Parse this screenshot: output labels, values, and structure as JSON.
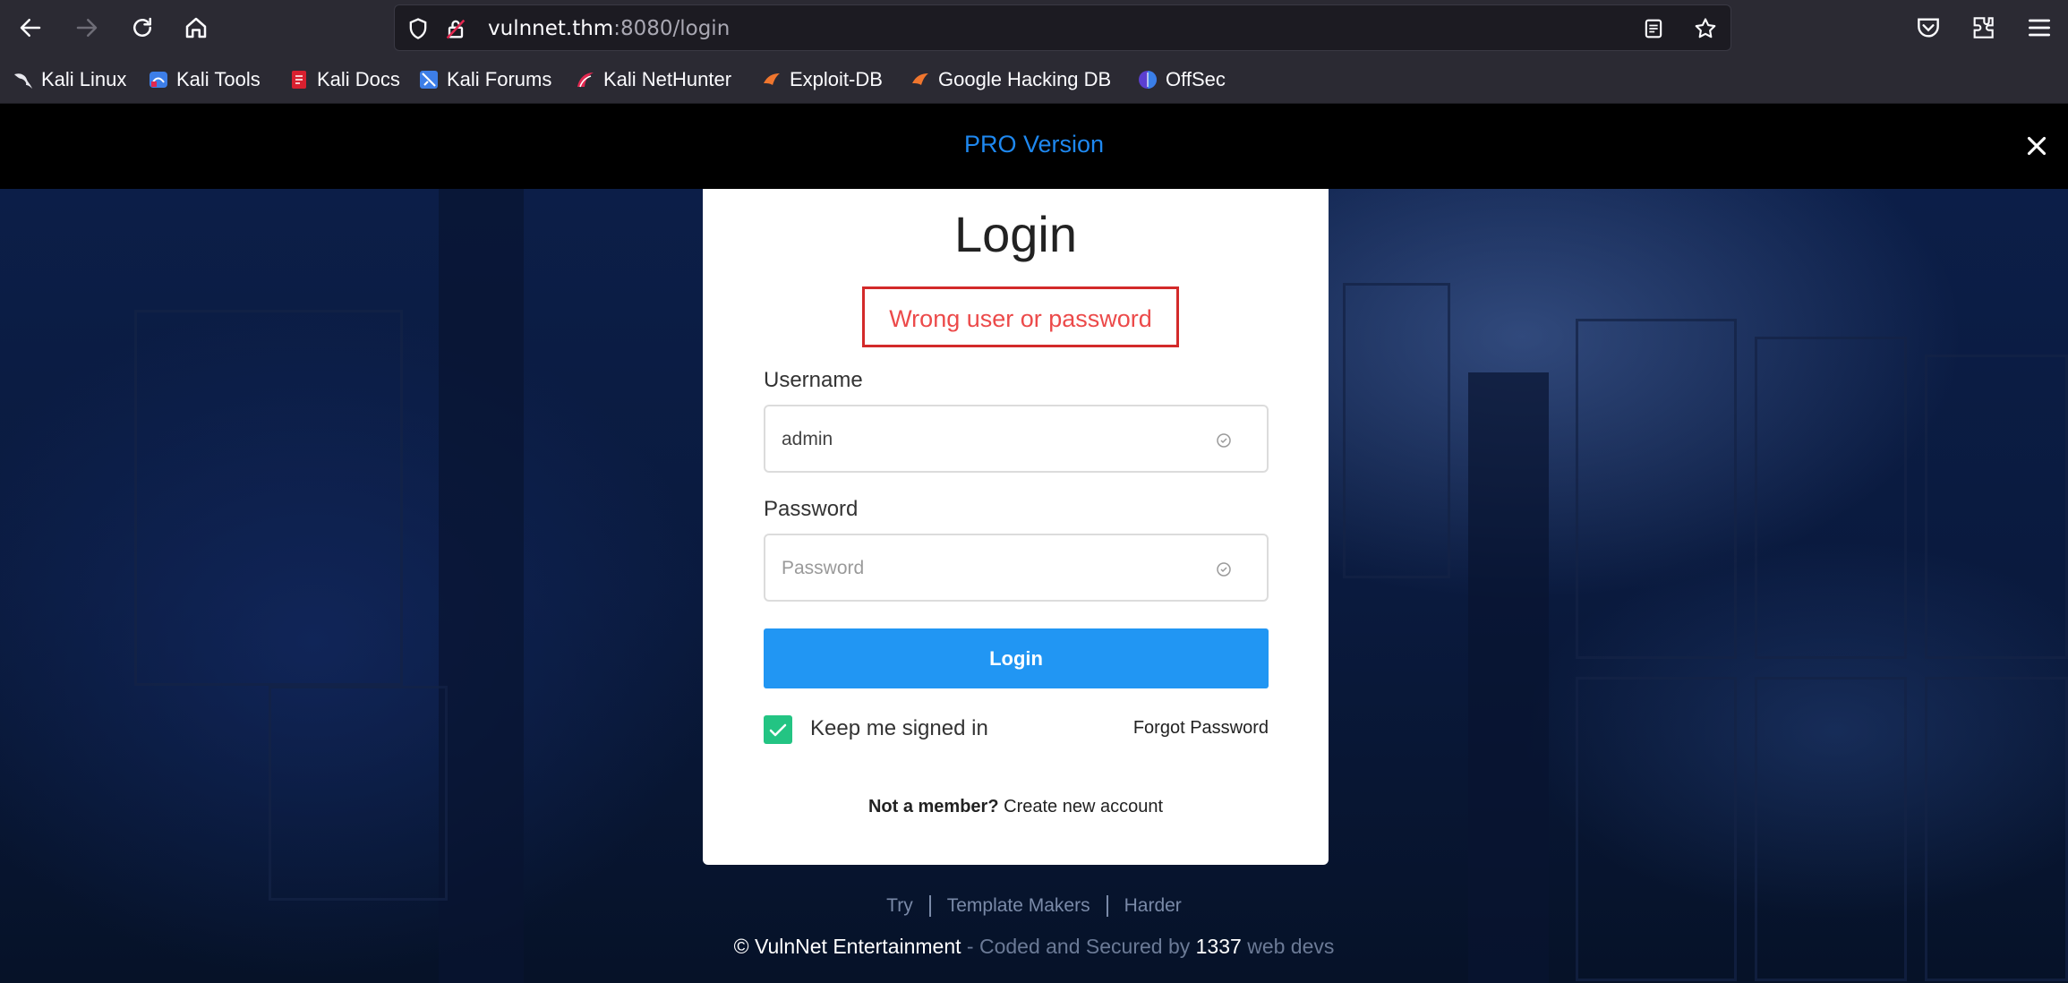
{
  "browser": {
    "url_host": "vulnnet.thm",
    "url_path": ":8080/login",
    "bookmarks": [
      {
        "label": "Kali Linux",
        "icon": "kali-dragon-icon"
      },
      {
        "label": "Kali Tools",
        "icon": "kali-tools-icon"
      },
      {
        "label": "Kali Docs",
        "icon": "kali-docs-icon"
      },
      {
        "label": "Kali Forums",
        "icon": "kali-forums-icon"
      },
      {
        "label": "Kali NetHunter",
        "icon": "nethunter-icon"
      },
      {
        "label": "Exploit-DB",
        "icon": "exploit-db-icon"
      },
      {
        "label": "Google Hacking DB",
        "icon": "ghdb-icon"
      },
      {
        "label": "OffSec",
        "icon": "offsec-icon"
      }
    ]
  },
  "banner": {
    "text": "PRO Version"
  },
  "login": {
    "title": "Login",
    "error": "Wrong user or password",
    "username_label": "Username",
    "username_value": "admin",
    "password_label": "Password",
    "password_placeholder": "Password",
    "submit_label": "Login",
    "keep_signed_in_label": "Keep me signed in",
    "keep_signed_in_checked": true,
    "forgot_label": "Forgot Password",
    "not_member": "Not a member?",
    "create_account": "Create new account"
  },
  "footer": {
    "links": [
      "Try",
      "Template Makers",
      "Harder"
    ],
    "copyright_symbol": "©",
    "company": "VulnNet Entertainment",
    "coded_text": " - Coded and Secured by ",
    "number": "1337",
    "devs_text": " web devs"
  },
  "colors": {
    "accent": "#2196f3",
    "banner_text": "#1e88f0",
    "error": "#ec4a4a",
    "checkbox": "#23c483"
  }
}
